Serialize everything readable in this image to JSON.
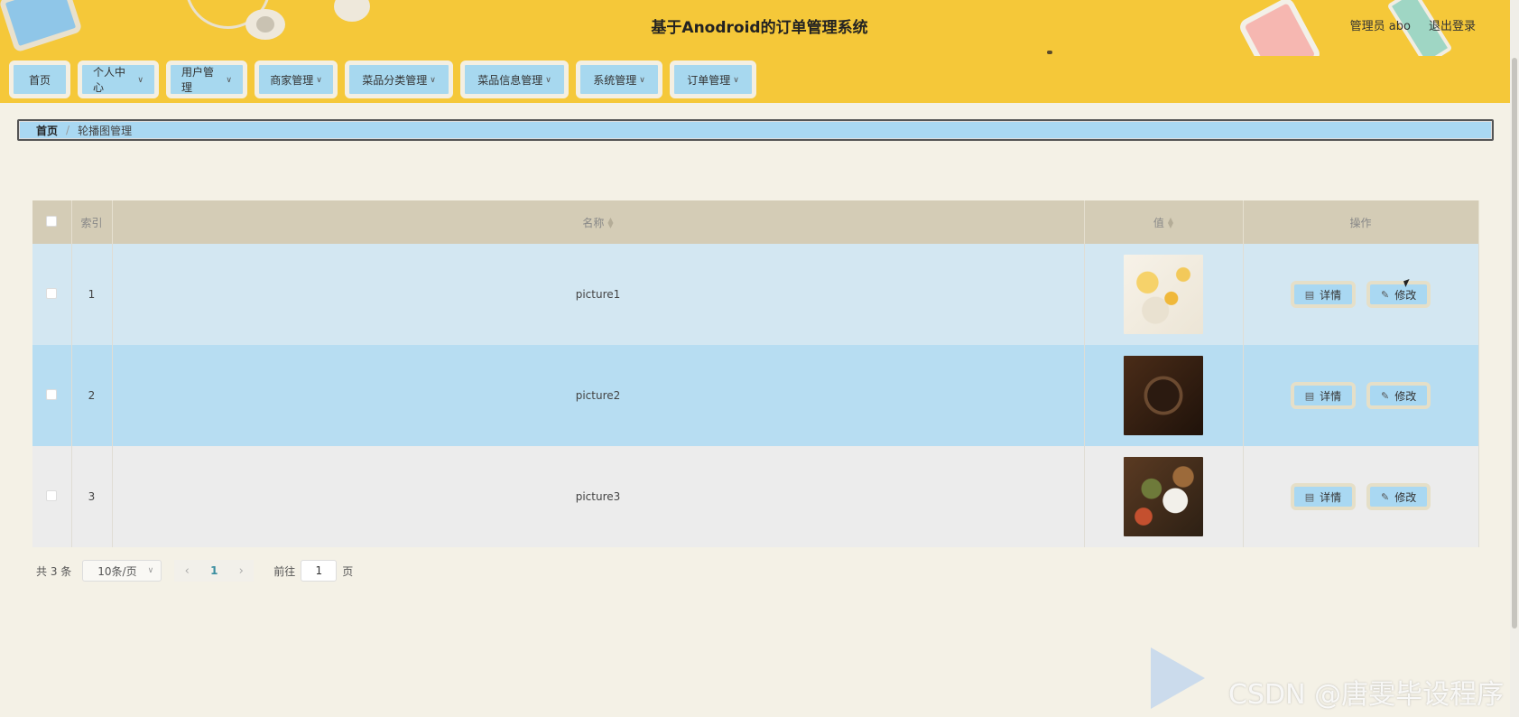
{
  "header": {
    "title": "基于Anodroid的订单管理系统",
    "user_label": "管理员 abo",
    "logout_label": "退出登录"
  },
  "nav": {
    "items": [
      {
        "label": "首页",
        "has_dropdown": false
      },
      {
        "label": "个人中心",
        "has_dropdown": true
      },
      {
        "label": "用户管理",
        "has_dropdown": true
      },
      {
        "label": "商家管理",
        "has_dropdown": true
      },
      {
        "label": "菜品分类管理",
        "has_dropdown": true
      },
      {
        "label": "菜品信息管理",
        "has_dropdown": true
      },
      {
        "label": "系统管理",
        "has_dropdown": true
      },
      {
        "label": "订单管理",
        "has_dropdown": true
      }
    ]
  },
  "breadcrumb": {
    "home": "首页",
    "separator": "/",
    "current": "轮播图管理"
  },
  "table": {
    "columns": {
      "index": "索引",
      "name": "名称",
      "value": "值",
      "actions": "操作"
    },
    "rows": [
      {
        "index": "1",
        "name": "picture1",
        "thumb": "food-photo-1"
      },
      {
        "index": "2",
        "name": "picture2",
        "thumb": "food-photo-2"
      },
      {
        "index": "3",
        "name": "picture3",
        "thumb": "food-photo-3"
      }
    ],
    "detail_label": "详情",
    "edit_label": "修改"
  },
  "pagination": {
    "total": "共 3 条",
    "page_size": "10条/页",
    "current_page": "1",
    "goto_label": "前往",
    "goto_value": "1",
    "page_unit": "页"
  },
  "watermark": {
    "text": "CSDN @唐雯毕设程序"
  },
  "colors": {
    "header_bg": "#f5c839",
    "nav_item_bg": "#a7d8ef",
    "page_bg": "#f4f1e6",
    "table_header_bg": "#d4ccb6",
    "row_odd_bg": "#d3e7f2",
    "row_even_bg": "#b7ddf2",
    "row_last_bg": "#ececec"
  }
}
